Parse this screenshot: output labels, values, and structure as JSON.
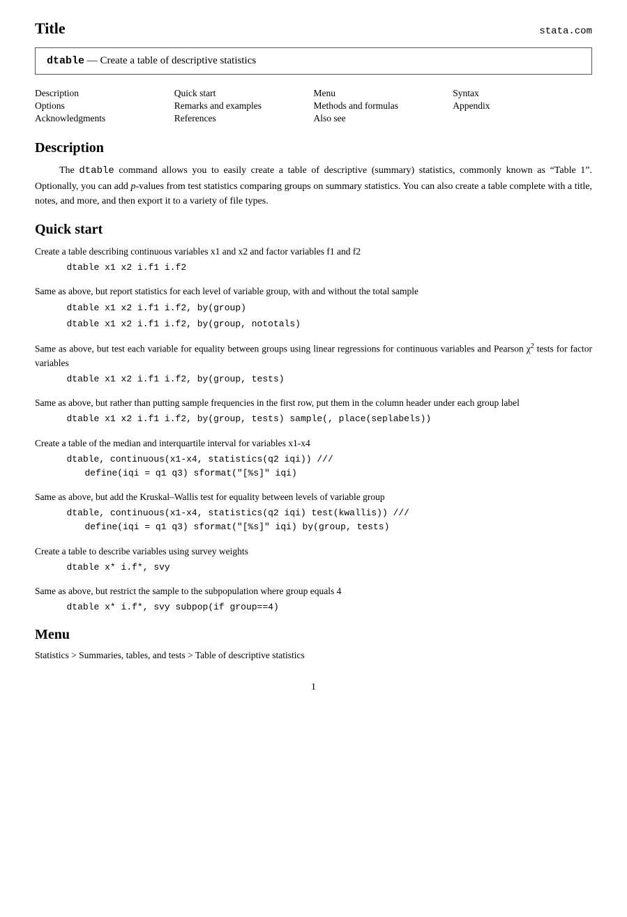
{
  "header": {
    "title": "Title",
    "site": "stata.com"
  },
  "title_box": {
    "cmd": "dtable",
    "separator": "—",
    "description": "Create a table of descriptive statistics"
  },
  "nav": {
    "col1": [
      "Description",
      "Options",
      "Acknowledgments"
    ],
    "col2": [
      "Quick start",
      "Remarks and examples",
      "References"
    ],
    "col3": [
      "Menu",
      "Methods and formulas",
      "Also see"
    ],
    "col4": [
      "Syntax",
      "Appendix"
    ]
  },
  "description": {
    "heading": "Description",
    "text": "The dtable command allows you to easily create a table of descriptive (summary) statistics, commonly known as “Table 1”. Optionally, you can add p-values from test statistics comparing groups on summary statistics. You can also create a table complete with a title, notes, and more, and then export it to a variety of file types."
  },
  "quick_start": {
    "heading": "Quick start",
    "items": [
      {
        "desc": "Create a table describing continuous variables x1 and x2 and factor variables f1 and f2",
        "code": [
          "dtable x1 x2 i.f1 i.f2"
        ],
        "code_indent": []
      },
      {
        "desc": "Same as above, but report statistics for each level of variable group, with and without the total sample",
        "code": [
          "dtable x1 x2 i.f1 i.f2, by(group)",
          "dtable x1 x2 i.f1 i.f2, by(group, nototals)"
        ],
        "code_indent": []
      },
      {
        "desc": "Same as above, but test each variable for equality between groups using linear regressions for continuous variables and Pearson χ² tests for factor variables",
        "code": [
          "dtable x1 x2 i.f1 i.f2, by(group, tests)"
        ],
        "code_indent": []
      },
      {
        "desc": "Same as above, but rather than putting sample frequencies in the first row, put them in the column header under each group label",
        "code": [
          "dtable x1 x2 i.f1 i.f2, by(group, tests) sample(, place(seplabels))"
        ],
        "code_indent": []
      },
      {
        "desc": "Create a table of the median and interquartile interval for variables x1-x4",
        "code": [
          "dtable, continuous(x1-x4, statistics(q2 iqi)) ///"
        ],
        "code_indent": [
          "define(iqi = q1 q3) sformat(\"[%s]\" iqi)"
        ]
      },
      {
        "desc": "Same as above, but add the Kruskal–Wallis test for equality between levels of variable group",
        "code": [
          "dtable, continuous(x1-x4, statistics(q2 iqi) test(kwallis)) ///"
        ],
        "code_indent": [
          "define(iqi = q1 q3) sformat(\"[%s]\" iqi) by(group, tests)"
        ]
      },
      {
        "desc": "Create a table to describe variables using survey weights",
        "code": [
          "dtable x* i.f*, svy"
        ],
        "code_indent": []
      },
      {
        "desc": "Same as above, but restrict the sample to the subpopulation where group equals 4",
        "code": [
          "dtable x* i.f*, svy subpop(if group==4)"
        ],
        "code_indent": []
      }
    ]
  },
  "menu": {
    "heading": "Menu",
    "path": "Statistics > Summaries, tables, and tests > Table of descriptive statistics"
  },
  "page_number": "1"
}
